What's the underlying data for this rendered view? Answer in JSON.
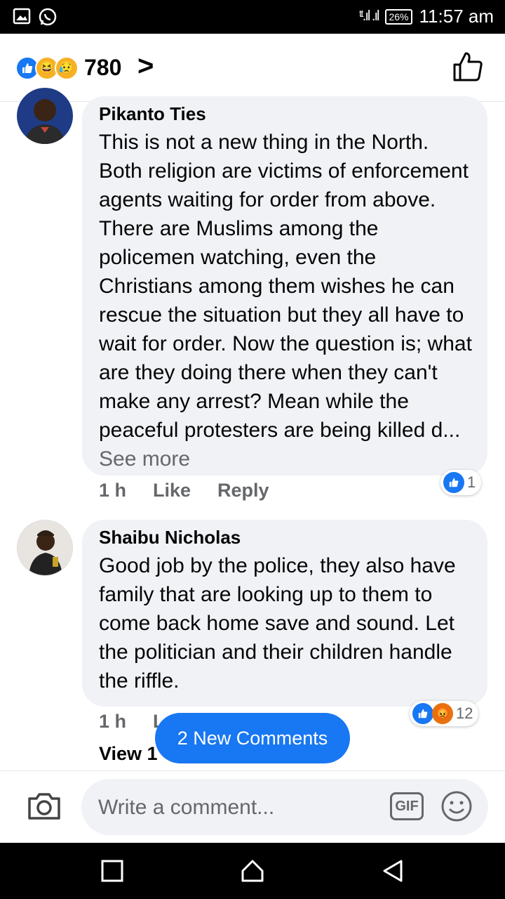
{
  "status_bar": {
    "battery": "26%",
    "time": "11:57 am"
  },
  "header": {
    "reaction_count": "780",
    "reaction_icons": [
      "like-icon",
      "haha-icon",
      "sad-icon"
    ]
  },
  "comments": [
    {
      "author": "Pikanto Ties",
      "text": "This is not a new thing in the North. Both religion are victims of enforcement agents waiting for order from above. There are Muslims among the policemen watching, even the Christians among them wishes he can rescue the situation but they all have to wait for order. Now the question is; what are they doing there when they can't make any arrest? Mean while the peaceful protesters are being killed d...",
      "see_more": "See more",
      "time": "1 h",
      "like_label": "Like",
      "reply_label": "Reply",
      "reaction_count": "1"
    },
    {
      "author": "Shaibu Nicholas",
      "text": "Good job by the police, they also have family that are looking up to them to come back home save and sound. Let the politician and their children handle the riffle.",
      "time": "1 h",
      "like_label": "L",
      "reaction_count": "12"
    }
  ],
  "view_replies": "View 1",
  "new_comments_button": "2 New Comments",
  "composer": {
    "placeholder": "Write a comment...",
    "gif_label": "GIF"
  },
  "colors": {
    "accent": "#1877f2",
    "bubble": "#f0f2f5",
    "meta_text": "#65676b"
  }
}
